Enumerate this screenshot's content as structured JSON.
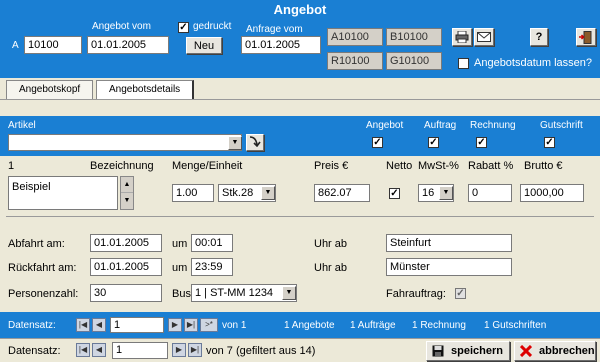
{
  "window": {
    "title": "Angebot"
  },
  "header": {
    "prefix": "A",
    "angebot_nr": "10100",
    "angebot_vom_label": "Angebot vom",
    "angebot_vom": "01.01.2005",
    "gedruckt_label": "gedruckt",
    "gedruckt_checked": true,
    "neu_label": "Neu",
    "anfrage_vom_label": "Anfrage vom",
    "anfrage_vom": "01.01.2005",
    "codes": [
      "A10100",
      "B10100",
      "R10100",
      "G10100"
    ],
    "help_label": "?",
    "datum_lassen_label": "Angebotsdatum lassen?",
    "datum_lassen_checked": false
  },
  "tabs": [
    {
      "label": "Angebotskopf",
      "active": false
    },
    {
      "label": "Angebotsdetails",
      "active": true
    }
  ],
  "article_bar": {
    "artikel_label": "Artikel",
    "artikel_value": "",
    "flags": [
      {
        "label": "Angebot",
        "checked": true
      },
      {
        "label": "Auftrag",
        "checked": true
      },
      {
        "label": "Rechnung",
        "checked": true
      },
      {
        "label": "Gutschrift",
        "checked": true
      }
    ]
  },
  "position": {
    "nr": "1",
    "bezeichnung_label": "Bezeichnung",
    "bezeichnung_value": "Beispiel",
    "menge_label": "Menge/Einheit",
    "menge_value": "1.00",
    "einheit_value": "Stk.28",
    "preis_label": "Preis €",
    "preis_value": "862.07",
    "netto_label": "Netto",
    "netto_checked": true,
    "mwst_label": "MwSt-%",
    "mwst_value": "16",
    "rabatt_label": "Rabatt %",
    "rabatt_value": "0",
    "brutto_label": "Brutto €",
    "brutto_value": "1000,00"
  },
  "trip": {
    "abfahrt_label": "Abfahrt am:",
    "abfahrt_date": "01.01.2005",
    "abfahrt_um_label": "um",
    "abfahrt_time": "00:01",
    "abfahrt_uhr_label": "Uhr ab",
    "abfahrt_ort": "Steinfurt",
    "rueckfahrt_label": "Rückfahrt am:",
    "rueckfahrt_date": "01.01.2005",
    "rueckfahrt_um_label": "um",
    "rueckfahrt_time": "23:59",
    "rueckfahrt_uhr_label": "Uhr ab",
    "rueckfahrt_ort": "Münster",
    "personen_label": "Personenzahl:",
    "personen_value": "30",
    "bus_label": "Bus",
    "bus_value": "1 | ST-MM 1234",
    "fahrauftrag_label": "Fahrauftrag:",
    "fahrauftrag_checked": true
  },
  "inner_nav": {
    "label": "Datensatz:",
    "current": "1",
    "new_symbol": ">*",
    "of_text": "von 1",
    "summary": [
      "1 Angebote",
      "1 Aufträge",
      "1 Rechnung",
      "1 Gutschriften"
    ]
  },
  "outer_nav": {
    "label": "Datensatz:",
    "current": "1",
    "of_text": "von 7 (gefiltert aus 14)",
    "save_label": "speichern",
    "cancel_label": "abbrechen"
  },
  "colors": {
    "accent": "#1a7fd3",
    "panel": "#ece9d8"
  }
}
